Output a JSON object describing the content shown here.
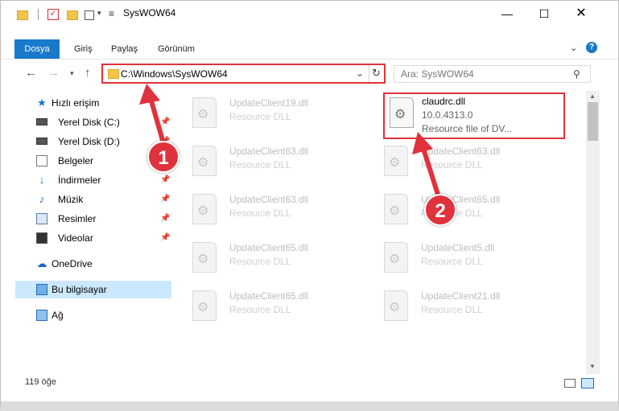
{
  "window": {
    "title": "SysWOW64",
    "controls": {
      "minimize": "—",
      "maximize": "☐",
      "close": "✕"
    }
  },
  "ribbon": {
    "tabs": [
      {
        "label": "Dosya",
        "active": true
      },
      {
        "label": "Giriş"
      },
      {
        "label": "Paylaş"
      },
      {
        "label": "Görünüm"
      }
    ],
    "help": "?"
  },
  "address_bar": {
    "path": "C:\\Windows\\SysWOW64",
    "refresh": "↻"
  },
  "search": {
    "placeholder": "Ara: SysWOW64",
    "icon": "search-icon"
  },
  "sidebar": {
    "items": [
      {
        "label": "Hızlı erişim",
        "icon": "star-icon"
      },
      {
        "label": "Yerel Disk (C:)",
        "icon": "drive-icon",
        "pinned": true
      },
      {
        "label": "Yerel Disk (D:)",
        "icon": "drive-icon",
        "pinned": true
      },
      {
        "label": "Belgeler",
        "icon": "document-icon",
        "pinned": true
      },
      {
        "label": "İndirmeler",
        "icon": "download-icon",
        "pinned": true
      },
      {
        "label": "Müzik",
        "icon": "music-icon",
        "pinned": true
      },
      {
        "label": "Resimler",
        "icon": "pictures-icon",
        "pinned": true
      },
      {
        "label": "Videolar",
        "icon": "video-icon",
        "pinned": true
      },
      {
        "label": "OneDrive",
        "icon": "cloud-icon"
      },
      {
        "label": "Bu bilgisayar",
        "icon": "computer-icon",
        "selected": true
      },
      {
        "label": "Ağ",
        "icon": "network-icon"
      }
    ]
  },
  "files": {
    "left_column": [
      {
        "name": "UpdateClient19.dll",
        "type": "Resource DLL"
      },
      {
        "name": "UpdateClient63.dll",
        "type": "Resource DLL"
      },
      {
        "name": "UpdateClient63.dll",
        "type": "Resource DLL"
      },
      {
        "name": "UpdateClient65.dll",
        "type": "Resource DLL"
      },
      {
        "name": "UpdateClient65.dll",
        "type": "Resource DLL"
      }
    ],
    "highlighted": {
      "name": "claudrc.dll",
      "version": "10.0.4313.0",
      "description": "Resource file of DV..."
    },
    "right_column": [
      {
        "name": "UpdateClient63.dll",
        "type": "Resource DLL"
      },
      {
        "name": "UpdateClient65.dll",
        "type": "Resource DLL"
      },
      {
        "name": "UpdateClient5.dll",
        "type": "Resource DLL"
      },
      {
        "name": "UpdateClient21.dll",
        "type": "Resource DLL"
      }
    ]
  },
  "statusbar": {
    "item_count": "119 öğe"
  },
  "annotations": {
    "step1": "1",
    "step2": "2",
    "color": "#e0323c"
  }
}
